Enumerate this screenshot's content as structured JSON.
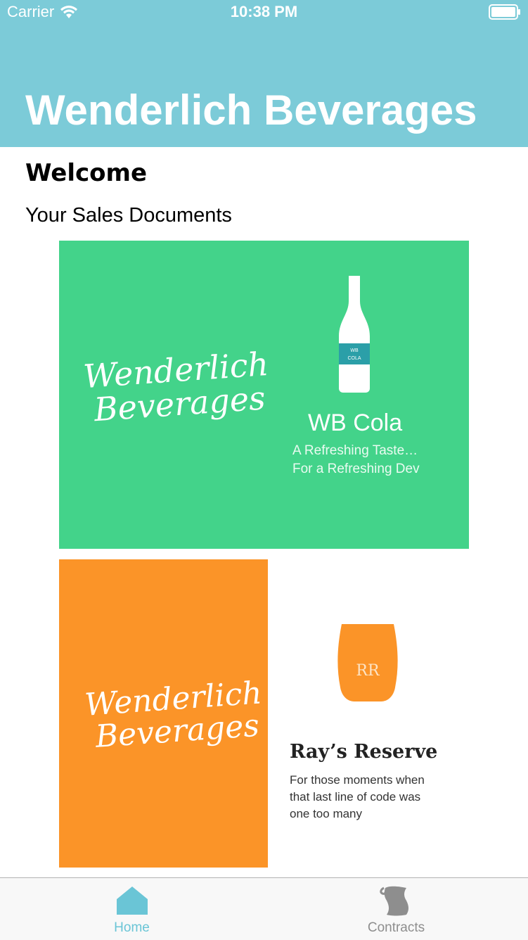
{
  "status_bar": {
    "carrier": "Carrier",
    "time": "10:38 PM",
    "icons": [
      "wifi-icon",
      "battery-icon"
    ]
  },
  "nav": {
    "title": "Wenderlich Beverages",
    "background": "#7ccbd8"
  },
  "content": {
    "welcome": "Welcome",
    "section_title": "Your Sales Documents"
  },
  "documents": [
    {
      "logo_line1": "Wenderlich",
      "logo_line2": "Beverages",
      "bottle_label_line1": "WB",
      "bottle_label_line2": "COLA",
      "title": "WB Cola",
      "tagline_line1": "A Refreshing Taste…",
      "tagline_line2": "For a Refreshing Dev",
      "background": "#43d38a"
    },
    {
      "logo_line1": "Wenderlich",
      "logo_line2": "Beverages",
      "cup_label": "RR",
      "title": "Ray’s Reserve",
      "tagline_line1": "For those moments when",
      "tagline_line2": "that last line of code was",
      "tagline_line3": "one too many",
      "background": "#fb9428"
    }
  ],
  "tab_bar": {
    "tabs": [
      {
        "label": "Home",
        "icon": "home-icon",
        "selected": true,
        "color": "#6ac5d6"
      },
      {
        "label": "Contracts",
        "icon": "scroll-icon",
        "selected": false,
        "color": "#8e8e8e"
      }
    ]
  }
}
